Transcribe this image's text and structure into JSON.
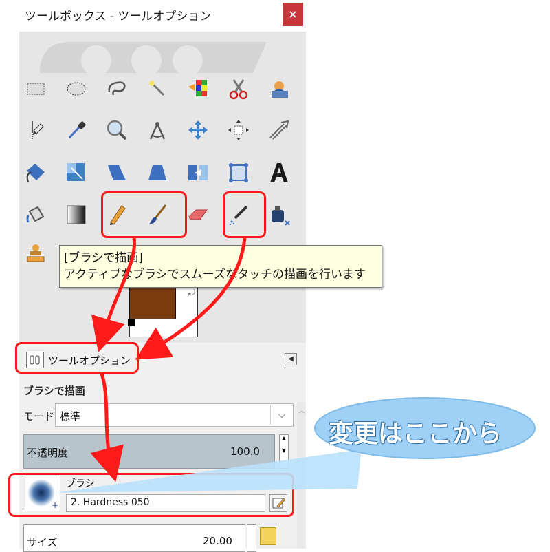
{
  "window": {
    "title": "ツールボックス - ツールオプション",
    "close_label": "×"
  },
  "tools": [
    {
      "name": "rect-select-icon"
    },
    {
      "name": "ellipse-select-icon"
    },
    {
      "name": "free-select-icon"
    },
    {
      "name": "fuzzy-select-icon"
    },
    {
      "name": "color-select-icon"
    },
    {
      "name": "scissors-icon"
    },
    {
      "name": "foreground-select-icon"
    },
    {
      "name": "paths-icon"
    },
    {
      "name": "color-picker-icon"
    },
    {
      "name": "zoom-icon"
    },
    {
      "name": "measure-icon"
    },
    {
      "name": "move-icon"
    },
    {
      "name": "align-icon"
    },
    {
      "name": "crop-icon"
    },
    {
      "name": "rotate-icon"
    },
    {
      "name": "scale-icon"
    },
    {
      "name": "shear-icon"
    },
    {
      "name": "perspective-icon"
    },
    {
      "name": "flip-icon"
    },
    {
      "name": "cage-icon"
    },
    {
      "name": "text-icon"
    },
    {
      "name": "bucket-fill-icon"
    },
    {
      "name": "gradient-icon"
    },
    {
      "name": "pencil-icon"
    },
    {
      "name": "paintbrush-icon"
    },
    {
      "name": "eraser-icon"
    },
    {
      "name": "airbrush-icon"
    },
    {
      "name": "ink-icon"
    },
    {
      "name": "clone-icon"
    }
  ],
  "tooltip": {
    "title": "[ブラシで描画]",
    "body": "アクティブなブラシでスムーズなタッチの描画を行います"
  },
  "colors": {
    "foreground": "#7a3b0f",
    "background": "#ffffff",
    "annotation": "#ff1a1a",
    "callout_fill": "#9fd0f5"
  },
  "dock_tab": {
    "label": "ツールオプション"
  },
  "options": {
    "title": "ブラシで描画",
    "mode_label": "モード:",
    "mode_value": "標準",
    "opacity_label": "不透明度",
    "opacity_value": "100.0",
    "brush_label": "ブラシ",
    "brush_name": "2. Hardness 050",
    "size_label": "サイズ",
    "size_value": "20.00"
  },
  "callout": {
    "text": "変更はここから"
  }
}
